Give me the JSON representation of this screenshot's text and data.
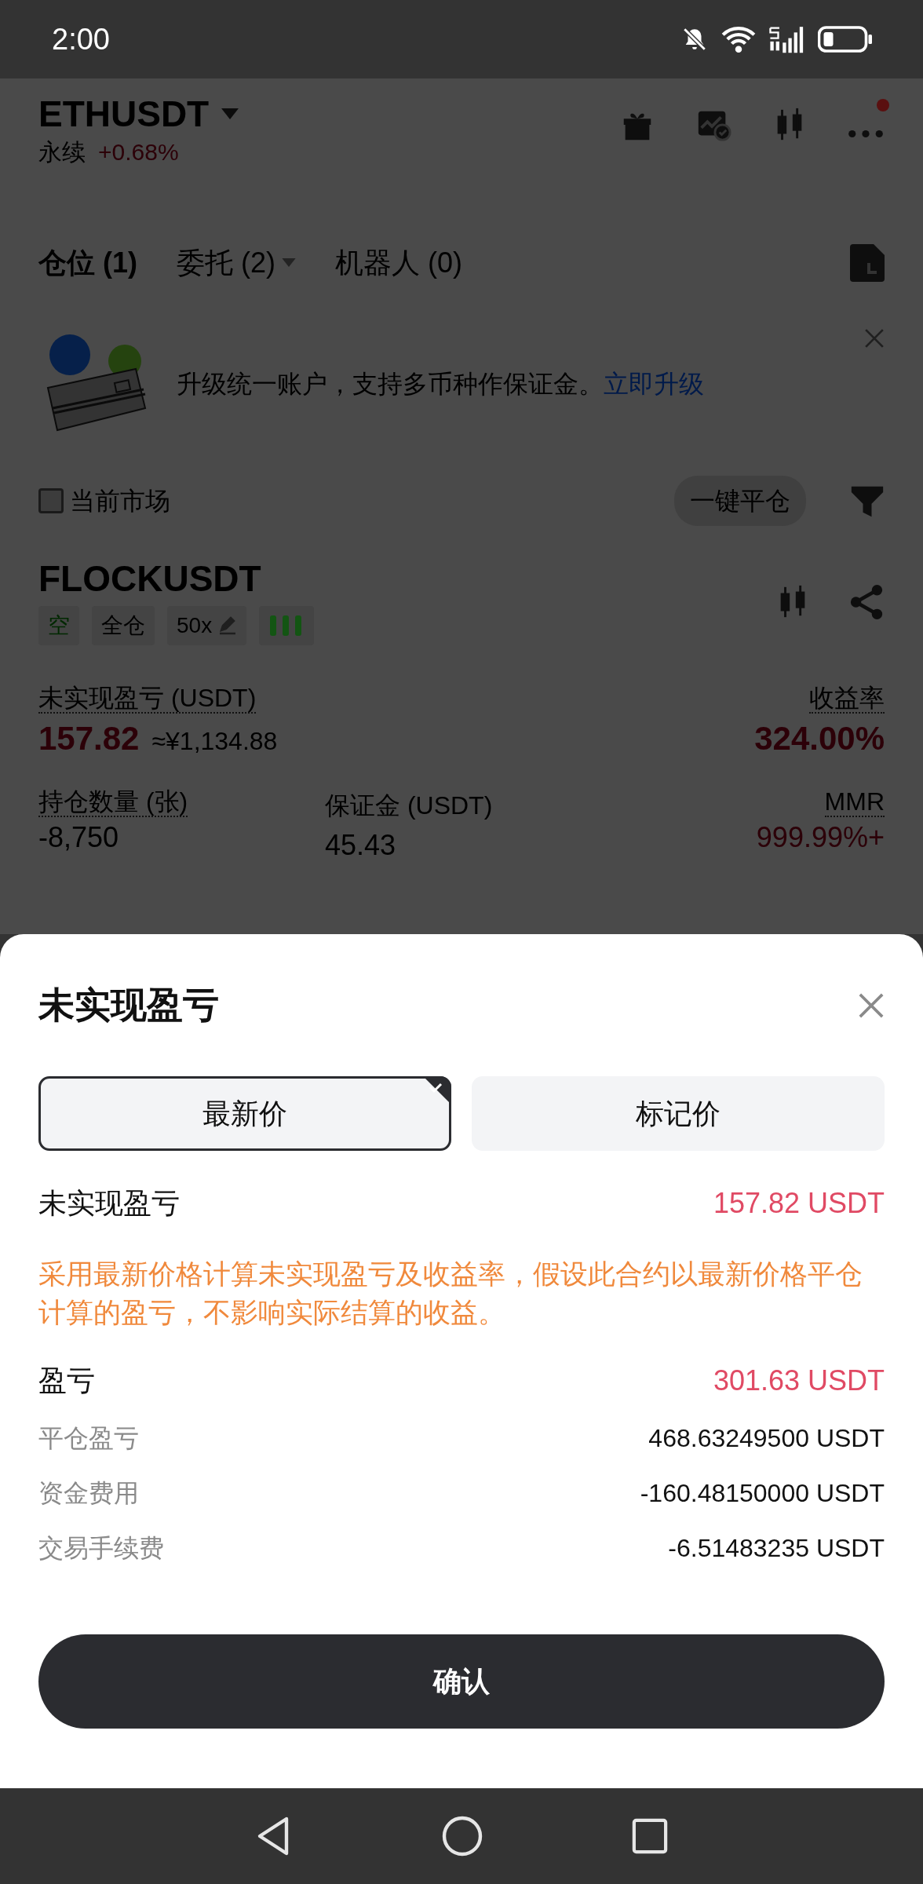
{
  "status_bar": {
    "time": "2:00"
  },
  "header": {
    "symbol": "ETHUSDT",
    "type": "永续",
    "change": "+0.68%",
    "notification_dot": true
  },
  "tabs": [
    {
      "label": "仓位 (1)",
      "selected": true,
      "has_dropdown": false
    },
    {
      "label": "委托 (2)",
      "selected": false,
      "has_dropdown": true
    },
    {
      "label": "机器人 (0)",
      "selected": false,
      "has_dropdown": false
    }
  ],
  "banner": {
    "text": "升级统一账户，支持多币种作保证金。",
    "link": "立即升级"
  },
  "filter": {
    "label": "当前市场",
    "checked": false,
    "close_all": "一键平仓"
  },
  "position": {
    "symbol": "FLOCKUSDT",
    "tags": [
      {
        "kind": "side",
        "label": "空"
      },
      {
        "kind": "plain",
        "label": "全仓"
      },
      {
        "kind": "leverage",
        "label": "50x"
      },
      {
        "kind": "bars"
      }
    ],
    "pnl": {
      "label": "未实现盈亏 (USDT)",
      "value": "157.82",
      "approx": "≈¥1,134.88"
    },
    "roe": {
      "label": "收益率",
      "value": "324.00%"
    },
    "stats": [
      {
        "label": "持仓数量 (张)",
        "value": "-8,750",
        "kind": "plain"
      },
      {
        "label": "保证金 (USDT)",
        "value": "45.43",
        "kind": "plain"
      },
      {
        "label": "MMR",
        "value": "999.99%+",
        "kind": "risk"
      }
    ]
  },
  "sheet": {
    "title": "未实现盈亏",
    "options": [
      {
        "label": "最新价",
        "selected": true
      },
      {
        "label": "标记价",
        "selected": false
      }
    ],
    "summary": {
      "label": "未实现盈亏",
      "value": "157.82 USDT"
    },
    "note": "采用最新价格计算未实现盈亏及收益率，假设此合约以最新价格平仓计算的盈亏，不影响实际结算的收益。",
    "total": {
      "label": "盈亏",
      "value": "301.63 USDT"
    },
    "details": [
      {
        "label": "平仓盈亏",
        "value": "468.63249500 USDT"
      },
      {
        "label": "资金费用",
        "value": "-160.48150000 USDT"
      },
      {
        "label": "交易手续费",
        "value": "-6.51483235 USDT"
      }
    ],
    "confirm": "确认"
  }
}
